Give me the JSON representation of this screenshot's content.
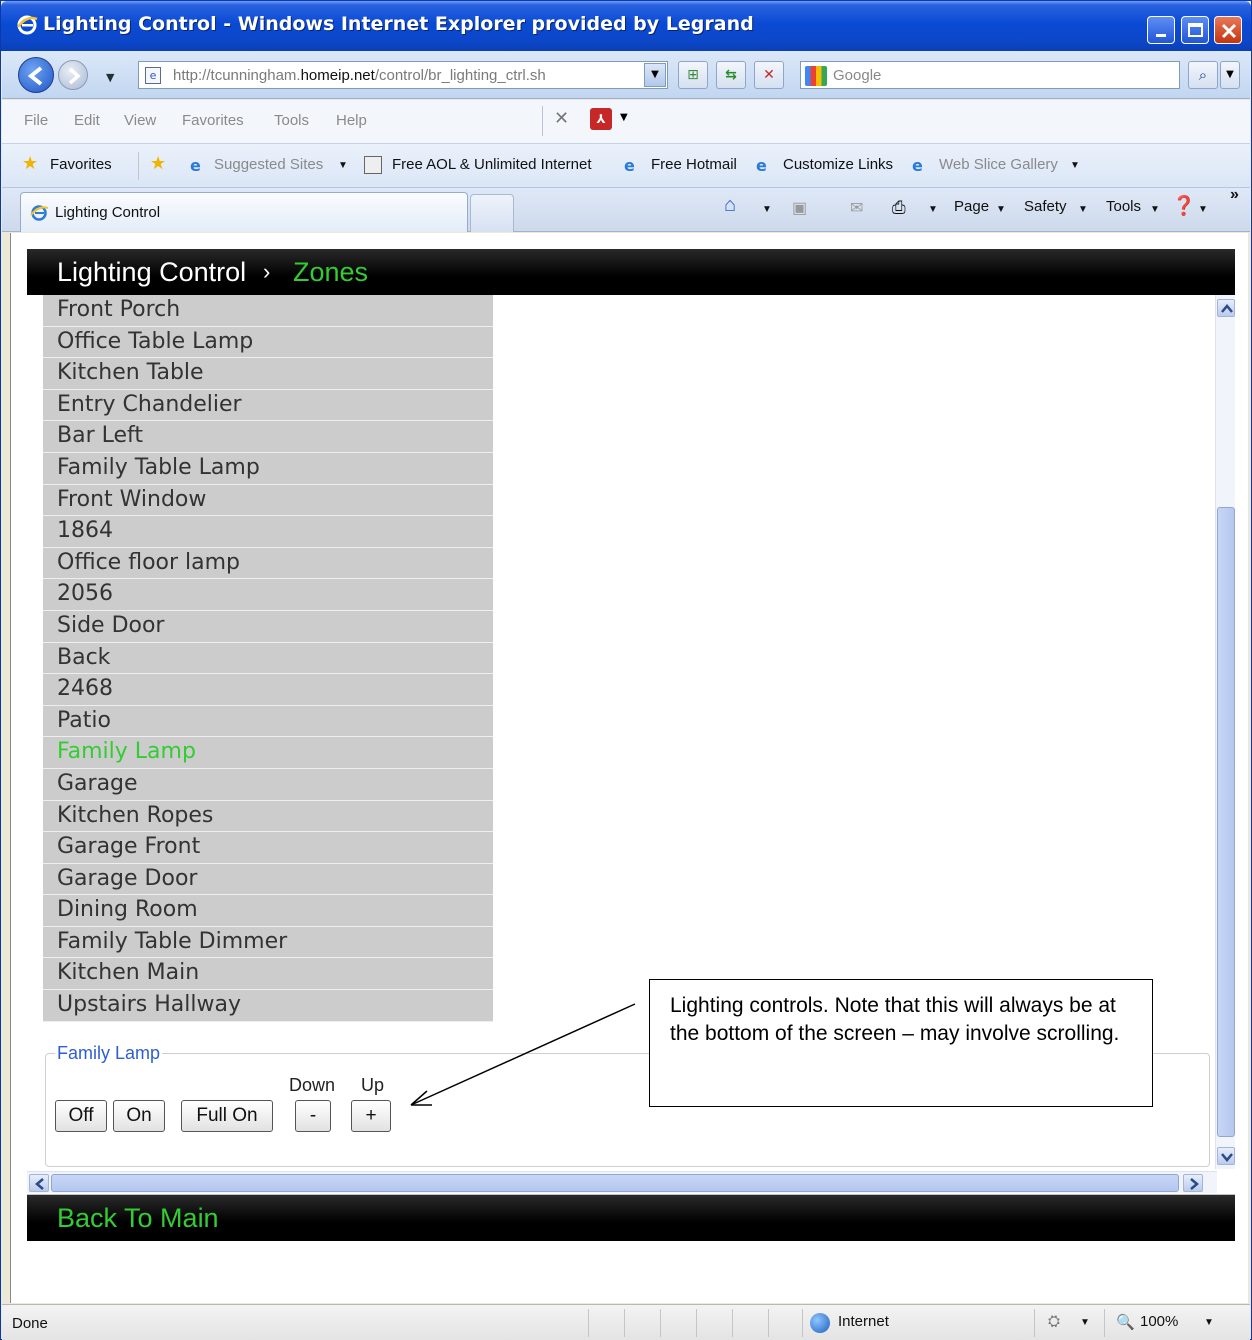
{
  "window": {
    "title": "Lighting Control - Windows Internet Explorer provided by Legrand"
  },
  "navbar": {
    "url_prefix": "http://tcunningham.",
    "url_host": "homeip.net",
    "url_path": "/control/br_lighting_ctrl.sh",
    "search_placeholder": "Google"
  },
  "menubar": {
    "items": [
      "File",
      "Edit",
      "View",
      "Favorites",
      "Tools",
      "Help"
    ]
  },
  "favbar": {
    "favorites_label": "Favorites",
    "links": [
      {
        "label": "Suggested Sites",
        "dim": true
      },
      {
        "label": "Free AOL & Unlimited Internet",
        "dim": false
      },
      {
        "label": "Free Hotmail",
        "dim": false
      },
      {
        "label": "Customize Links",
        "dim": false
      },
      {
        "label": "Web Slice Gallery",
        "dim": true
      }
    ]
  },
  "tabs": {
    "active_label": "Lighting Control",
    "commands": [
      "Page",
      "Safety",
      "Tools"
    ]
  },
  "app": {
    "breadcrumb_root": "Lighting Control",
    "breadcrumb_sep": "›",
    "breadcrumb_current": "Zones",
    "zones": [
      "Front Porch",
      "Office Table Lamp",
      "Kitchen Table",
      "Entry Chandelier",
      "Bar Left",
      "Family Table Lamp",
      "Front Window",
      "1864",
      "Office floor lamp",
      "2056",
      "Side Door",
      "Back",
      "2468",
      "Patio",
      "Family Lamp",
      "Garage",
      "Kitchen Ropes",
      "Garage Front",
      "Garage Door",
      "Dining Room",
      "Family Table Dimmer",
      "Kitchen Main",
      "Upstairs Hallway"
    ],
    "selected_zone": "Family Lamp",
    "controls": {
      "legend": "Family Lamp",
      "off": "Off",
      "on": "On",
      "full_on": "Full On",
      "down_label": "Down",
      "up_label": "Up",
      "down_button": "-",
      "up_button": "+"
    },
    "footer_link": "Back To Main"
  },
  "annotation": {
    "text": "Lighting controls.  Note that this will always be at the bottom of the screen – may involve  scrolling."
  },
  "statusbar": {
    "status": "Done",
    "zone": "Internet",
    "zoom": "100%"
  },
  "colors": {
    "accent_green": "#33cc33",
    "zone_bg": "#cccccc",
    "header_bg": "#000000",
    "legend_blue": "#2d5fd3",
    "titlebar_blue": "#0a4ad4"
  }
}
